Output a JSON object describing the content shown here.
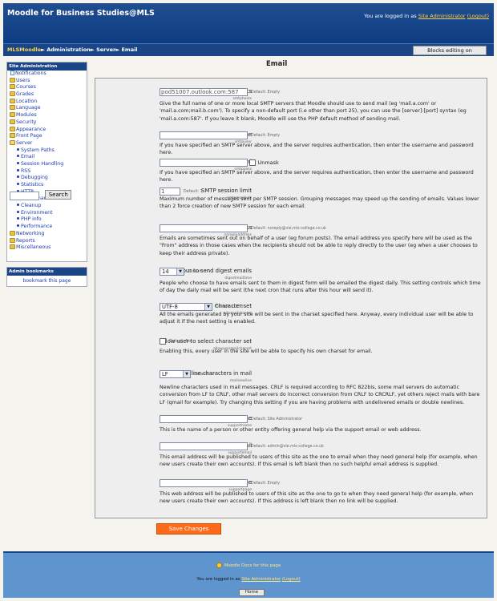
{
  "header": {
    "site_name": "Moodle for Business Studies@MLS",
    "login_prefix": "You are logged in as",
    "user": "Site Administrator",
    "logout": "(Logout)"
  },
  "navbar": {
    "home": "MLSMoodle",
    "sep": "►",
    "crumb1": "Administration",
    "crumb2": "Server",
    "crumb3": "Email",
    "edit_button": "Blocks editing on"
  },
  "sidebar": {
    "title": "Site Administration",
    "items": [
      {
        "label": "Notifications",
        "icon": "doc-icon",
        "level": 0
      },
      {
        "label": "Users",
        "icon": "folder-icon",
        "level": 0
      },
      {
        "label": "Courses",
        "icon": "folder-icon",
        "level": 0
      },
      {
        "label": "Grades",
        "icon": "folder-icon",
        "level": 0
      },
      {
        "label": "Location",
        "icon": "folder-icon",
        "level": 0
      },
      {
        "label": "Language",
        "icon": "folder-icon",
        "level": 0
      },
      {
        "label": "Modules",
        "icon": "folder-icon",
        "level": 0
      },
      {
        "label": "Security",
        "icon": "folder-icon",
        "level": 0
      },
      {
        "label": "Appearance",
        "icon": "folder-icon",
        "level": 0
      },
      {
        "label": "Front Page",
        "icon": "folder-icon",
        "level": 0
      },
      {
        "label": "Server",
        "icon": "folder-open-icon",
        "level": 0
      },
      {
        "label": "System Paths",
        "icon": "bullet-icon",
        "level": 1
      },
      {
        "label": "Email",
        "icon": "bullet-icon",
        "level": 1
      },
      {
        "label": "Session Handling",
        "icon": "bullet-icon",
        "level": 1
      },
      {
        "label": "RSS",
        "icon": "bullet-icon",
        "level": 1
      },
      {
        "label": "Debugging",
        "icon": "bullet-icon",
        "level": 1
      },
      {
        "label": "Statistics",
        "icon": "bullet-icon",
        "level": 1
      },
      {
        "label": "HTTP",
        "icon": "bullet-icon",
        "level": 1
      },
      {
        "label": "Maintenance mode",
        "icon": "bullet-icon",
        "level": 1
      },
      {
        "label": "Cleanup",
        "icon": "bullet-icon",
        "level": 1
      },
      {
        "label": "Environment",
        "icon": "bullet-icon",
        "level": 1
      },
      {
        "label": "PHP info",
        "icon": "bullet-icon",
        "level": 1
      },
      {
        "label": "Performance",
        "icon": "bullet-icon",
        "level": 1
      },
      {
        "label": "Networking",
        "icon": "folder-icon",
        "level": 0
      },
      {
        "label": "Reports",
        "icon": "folder-icon",
        "level": 0
      },
      {
        "label": "Miscellaneous",
        "icon": "folder-icon",
        "level": 0
      }
    ],
    "search_value": "",
    "search_button": "Search"
  },
  "bookmarks": {
    "title": "Admin bookmarks",
    "link": "bookmark this page"
  },
  "main": {
    "title": "Email",
    "settings": [
      {
        "label": "SMTP hosts",
        "config": "smtphosts",
        "type": "text",
        "value": "pod51007.outlook.com:587",
        "width": 110,
        "default": "Default: Empty",
        "desc": "Give the full name of one or more local SMTP servers that Moodle should use to send mail (eg 'mail.a.com' or 'mail.a.com;mail.b.com'). To specify a non-default port (i.e other than port 25), you can use the [server]:[port] syntax (eg 'mail.a.com:587'. If you leave it blank, Moodle will use the PHP default method of sending mail."
      },
      {
        "label": "SMTP username",
        "config": "smtpuser",
        "type": "text",
        "value": "",
        "width": 110,
        "default": "Default: Empty",
        "desc": "If you have specified an SMTP server above, and the server requires authentication, then enter the username and password here."
      },
      {
        "label": "SMTP password",
        "config": "smtppass",
        "type": "password",
        "value": "",
        "width": 110,
        "extra": "Unmask",
        "default": "",
        "desc": "If you have specified an SMTP server above, and the server requires authentication, then enter the username and password here."
      },
      {
        "label": "SMTP session limit",
        "config": "smtpmaxbulk",
        "type": "text",
        "value": "1",
        "width": 26,
        "default": "Default: 1",
        "desc": "Maximum number of messages sent per SMTP session. Grouping messages may speed up the sending of emails. Values lower than 2 force creation of new SMTP session for each email."
      },
      {
        "label": "No-reply address",
        "config": "noreplyaddress",
        "type": "text",
        "value": "",
        "width": 110,
        "default": "Default: noreply@vle.mls-college.co.uk",
        "desc": "Emails are sometimes sent out on behalf of a user (eg forum posts). The email address you specify here will be used as the \"From\" address in those cases when the recipients should not be able to reply directly to the user (eg when a user chooses to keep their address private)."
      },
      {
        "label": "Hour to send digest emails",
        "config": "digestmailtime",
        "type": "select",
        "value": "14",
        "width": 22,
        "default": "Default: 17",
        "desc": "People who choose to have emails sent to them in digest form will be emailed the digest daily. This setting controls which time of day the daily mail will be sent (the next cron that runs after this hour will send it)."
      },
      {
        "label": "Character set",
        "config": "sitemailcharset",
        "type": "select",
        "value": "UTF-8",
        "width": 57,
        "default": "Default: UTF-8",
        "desc": "All the emails generated by your site will be sent in the charset specified here. Anyway, every individual user will be able to adjust it if the next setting is enabled."
      },
      {
        "label": "Allow user to select character set",
        "config": "allowusermailcharset",
        "type": "checkbox",
        "value": "",
        "width": 8,
        "default": "Default: No",
        "desc": "Enabling this, every user in the site will be able to specify his own charset for email."
      },
      {
        "label": "Newline characters in mail",
        "config": "mailnewline",
        "type": "select",
        "value": "LF",
        "width": 30,
        "default": "Default: LF",
        "desc": "Newline characters used in mail messages. CRLF is required according to RFC 822bis, some mail servers do automatic conversion from LF to CRLF, other mail servers do incorrect conversion from CRLF to CRCRLF, yet others reject mails with bare LF (qmail for example). Try changing this setting if you are having problems with undelivered emails or double newlines."
      },
      {
        "label": "Support name",
        "config": "supportname",
        "type": "text",
        "value": "",
        "width": 110,
        "default": "Default: Site Administrator",
        "desc": "This is the name of a person or other entity offering general help via the support email or web address."
      },
      {
        "label": "Support email",
        "config": "supportemail",
        "type": "text",
        "value": "",
        "width": 110,
        "default": "Default: admin@vle.mls-college.co.uk",
        "desc": "This email address will be published to users of this site as the one to email when they need general help (for example, when new users create their own accounts). If this email is left blank then no such helpful email address is supplied."
      },
      {
        "label": "Support page",
        "config": "supportpage",
        "type": "text",
        "value": "",
        "width": 110,
        "default": "Default: Empty",
        "desc": "This web address will be published to users of this site as the one to go to when they need general help (for example, when new users create their own accounts). If this address is left blank then no link will be supplied."
      }
    ],
    "save_button": "Save Changes"
  },
  "footer": {
    "docs_link": "Moodle Docs for this page",
    "login_prefix": "You are logged in as",
    "user": "Site Administrator",
    "logout": "(Logout)",
    "home_button": "Home"
  },
  "colors": {
    "header_blue": "#0e3c83",
    "link_yellow": "#ffd24a",
    "save_orange": "#ff6a1a",
    "footer_blue": "#5f95cf"
  }
}
